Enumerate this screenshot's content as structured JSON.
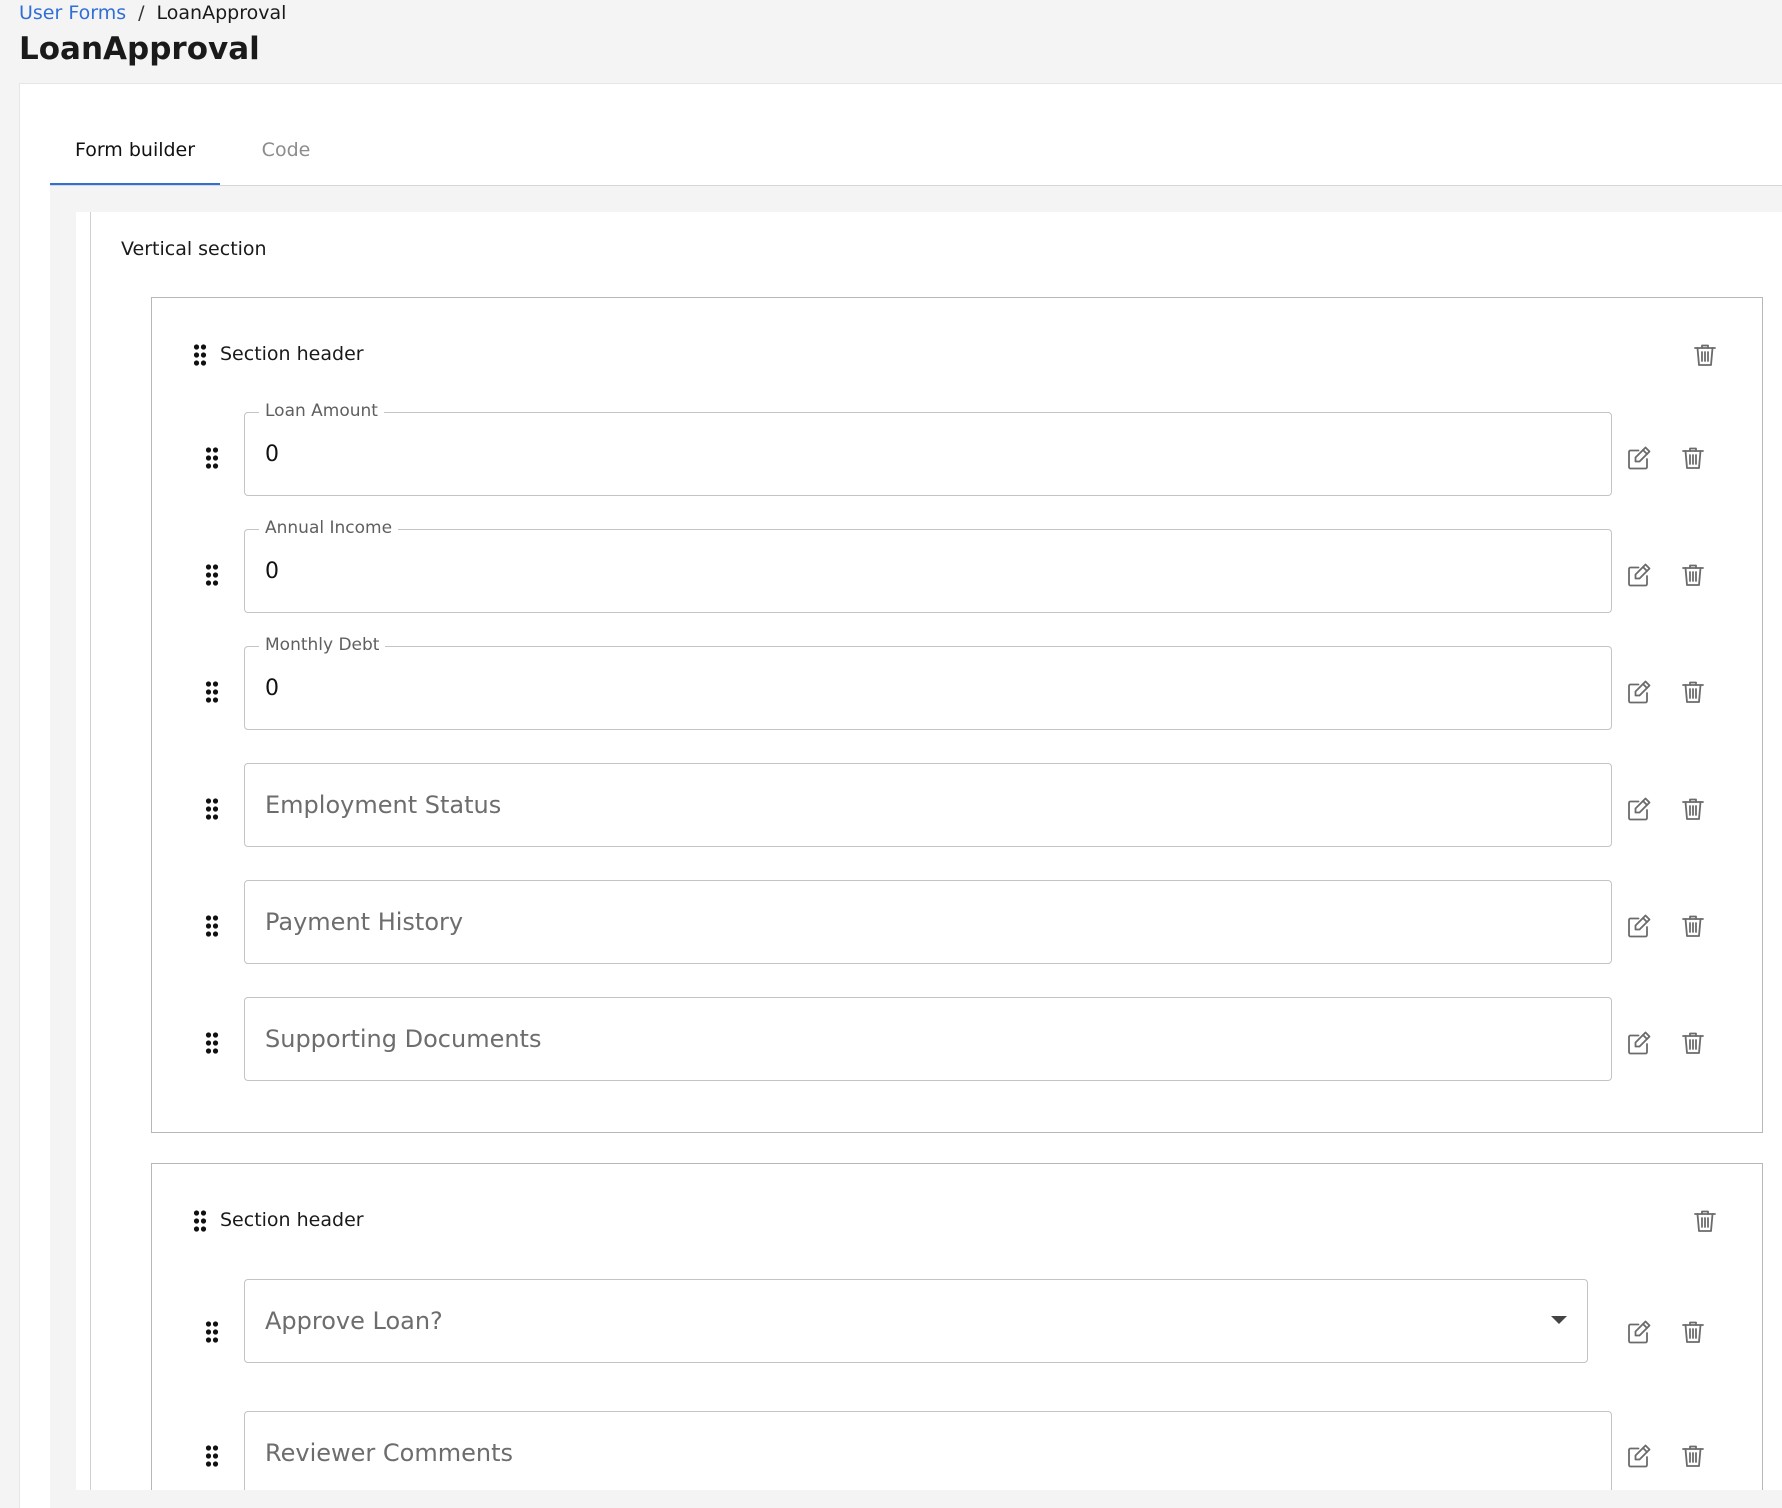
{
  "breadcrumb": {
    "parent": "User Forms",
    "separator": "/",
    "current": "LoanApproval"
  },
  "page": {
    "title": "LoanApproval"
  },
  "tabs": [
    {
      "label": "Form builder",
      "active": true
    },
    {
      "label": "Code",
      "active": false
    }
  ],
  "builder": {
    "vertical_section_label": "Vertical section",
    "sections": [
      {
        "header": "Section header",
        "fields": [
          {
            "label": "Loan Amount",
            "value": "0"
          },
          {
            "label": "Annual Income",
            "value": "0"
          },
          {
            "label": "Monthly Debt",
            "value": "0"
          },
          {
            "placeholder": "Employment Status"
          },
          {
            "placeholder": "Payment History"
          },
          {
            "placeholder": "Supporting Documents"
          }
        ]
      },
      {
        "header": "Section header",
        "fields": [
          {
            "placeholder": "Approve Loan?",
            "type": "select"
          },
          {
            "placeholder": "Reviewer Comments"
          }
        ]
      }
    ]
  },
  "colors": {
    "accent": "#2f6fd6",
    "border": "#c4c4c4",
    "icon": "#6b6b6b"
  },
  "icons": {
    "drag": "drag-handle-icon",
    "edit": "edit-icon",
    "delete": "trash-icon",
    "caret": "chevron-down-icon"
  }
}
